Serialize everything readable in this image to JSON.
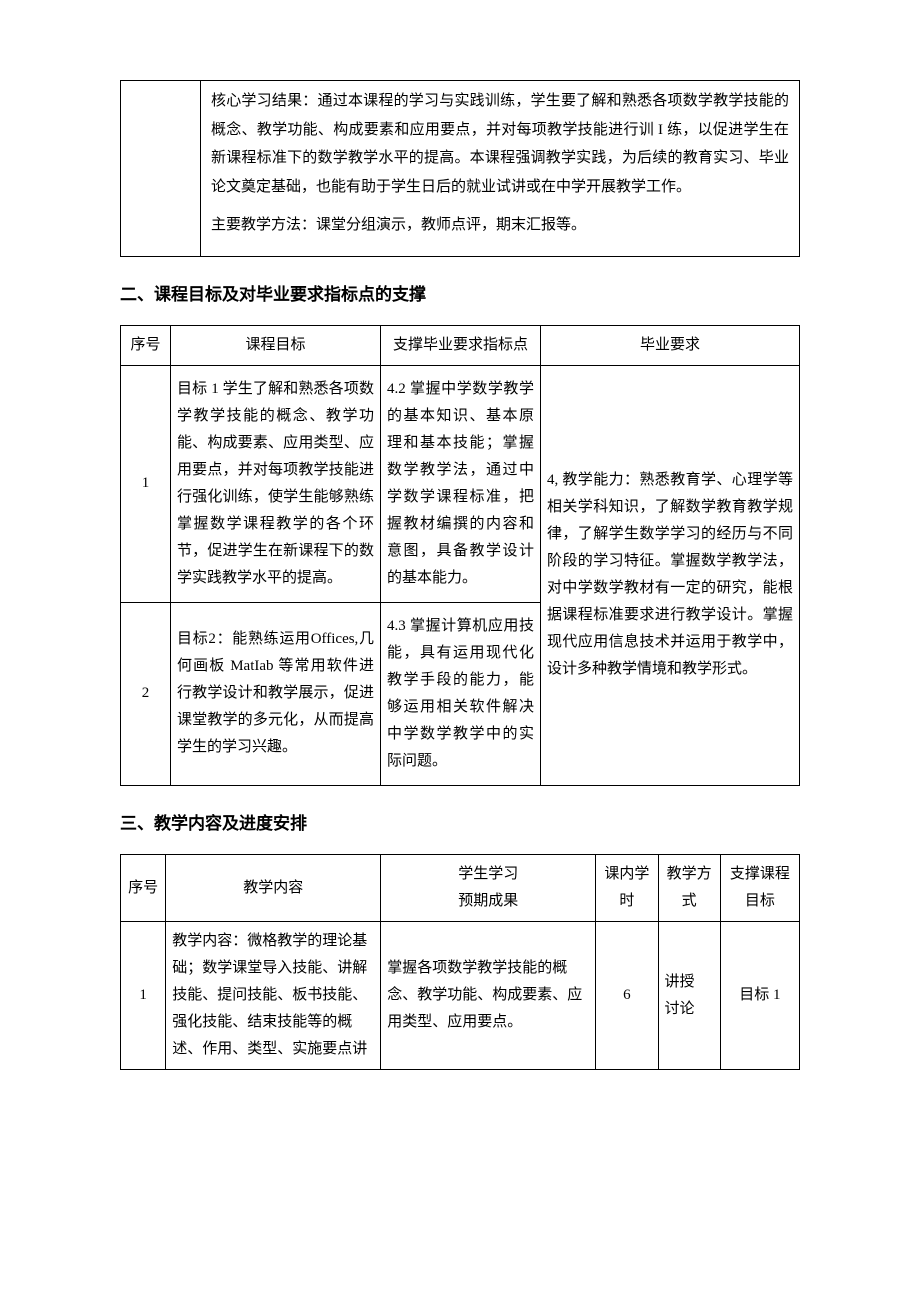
{
  "topBox": {
    "para1": "核心学习结果：通过本课程的学习与实践训练，学生要了解和熟悉各项数学教学技能的概念、教学功能、构成要素和应用要点，并对每项教学技能进行训 I 练，以促进学生在新课程标准下的数学教学水平的提高。本课程强调教学实践，为后续的教育实习、毕业论文奠定基础，也能有助于学生日后的就业试讲或在中学开展教学工作。",
    "para2": "主要教学方法：课堂分组演示，教师点评，期末汇报等。"
  },
  "section2": {
    "heading": "二、课程目标及对毕业要求指标点的支撑",
    "headers": {
      "seq": "序号",
      "goal": "课程目标",
      "point": "支撑毕业要求指标点",
      "req": "毕业要求"
    },
    "rows": [
      {
        "seq": "1",
        "goal": "目标 1 学生了解和熟悉各项数学教学技能的概念、教学功能、构成要素、应用类型、应用要点，并对每项教学技能进行强化训练，使学生能够熟练掌握数学课程教学的各个环节，促进学生在新课程下的数学实践教学水平的提高。",
        "point": "4.2 掌握中学数学教学的基本知识、基本原理和基本技能；掌握数学教学法，通过中学数学课程标准，把握教材编撰的内容和意图，具备教学设计的基本能力。"
      },
      {
        "seq": "2",
        "goal": "目标2：能熟练运用Offices,几何画板 MatIab 等常用软件进行教学设计和教学展示，促进课堂教学的多元化，从而提高学生的学习兴趣。",
        "point": "4.3 掌握计算机应用技能，具有运用现代化教学手段的能力，能够运用相关软件解决中学数学教学中的实际问题。"
      }
    ],
    "requirement": "4, 教学能力：熟悉教育学、心理学等相关学科知识，了解数学教育教学规律，了解学生数学学习的经历与不同阶段的学习特征。掌握数学教学法，对中学数学教材有一定的研究，能根据课程标准要求进行教学设计。掌握现代应用信息技术并运用于教学中，设计多种教学情境和教学形式。"
  },
  "section3": {
    "heading": "三、教学内容及进度安排",
    "headers": {
      "seq": "序号",
      "content": "教学内容",
      "outcome": "学生学习\n预期成果",
      "hours": "课内学时",
      "method": "教学方式",
      "support": "支撑课程目标"
    },
    "rows": [
      {
        "seq": "1",
        "content": "教学内容：微格教学的理论基础；数学课堂导入技能、讲解技能、提问技能、板书技能、强化技能、结束技能等的概述、作用、类型、实施要点讲",
        "outcome": "掌握各项数学教学技能的概念、教学功能、构成要素、应用类型、应用要点。",
        "hours": "6",
        "method": "讲授\n讨论",
        "support": "目标 1"
      }
    ]
  }
}
